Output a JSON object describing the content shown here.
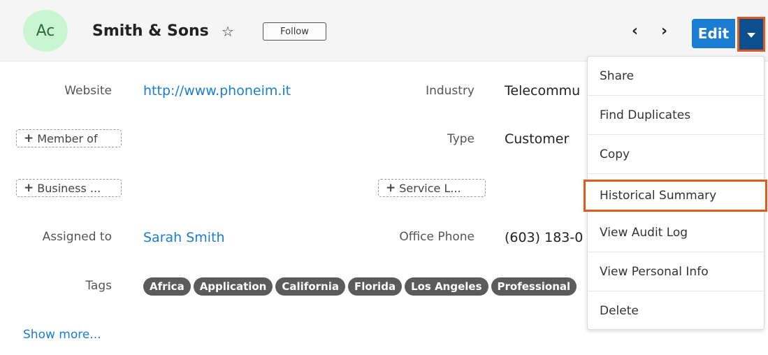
{
  "header": {
    "avatar_initials": "Ac",
    "record_name": "Smith & Sons",
    "favorite_icon": "star-outline-icon",
    "follow_label": "Follow",
    "prev_icon": "chevron-left-icon",
    "next_icon": "chevron-right-icon",
    "edit_label": "Edit",
    "actions_icon": "caret-down-icon"
  },
  "fields": {
    "website_label": "Website",
    "website_value": "http://www.phoneim.it",
    "industry_label": "Industry",
    "industry_value": "Telecommu",
    "member_of_label": "Member of",
    "type_label": "Type",
    "type_value": "Customer",
    "business_label": "Business ...",
    "service_label": "Service L...",
    "assigned_label": "Assigned to",
    "assigned_value": "Sarah Smith",
    "office_phone_label": "Office Phone",
    "office_phone_value": "(603) 183-0",
    "tags_label": "Tags",
    "tags": [
      "Africa",
      "Application",
      "California",
      "Florida",
      "Los Angeles",
      "Professional"
    ]
  },
  "show_more": "Show more...",
  "actions_menu": {
    "items": [
      "Share",
      "Find Duplicates",
      "Copy",
      "Historical Summary",
      "View Audit Log",
      "View Personal Info",
      "Delete"
    ],
    "highlighted": "Historical Summary"
  },
  "colors": {
    "accent": "#1a7dd2",
    "highlight_outline": "#e0591f",
    "avatar_bg": "#c9f5d2",
    "tag_bg": "#5b5b5b"
  }
}
